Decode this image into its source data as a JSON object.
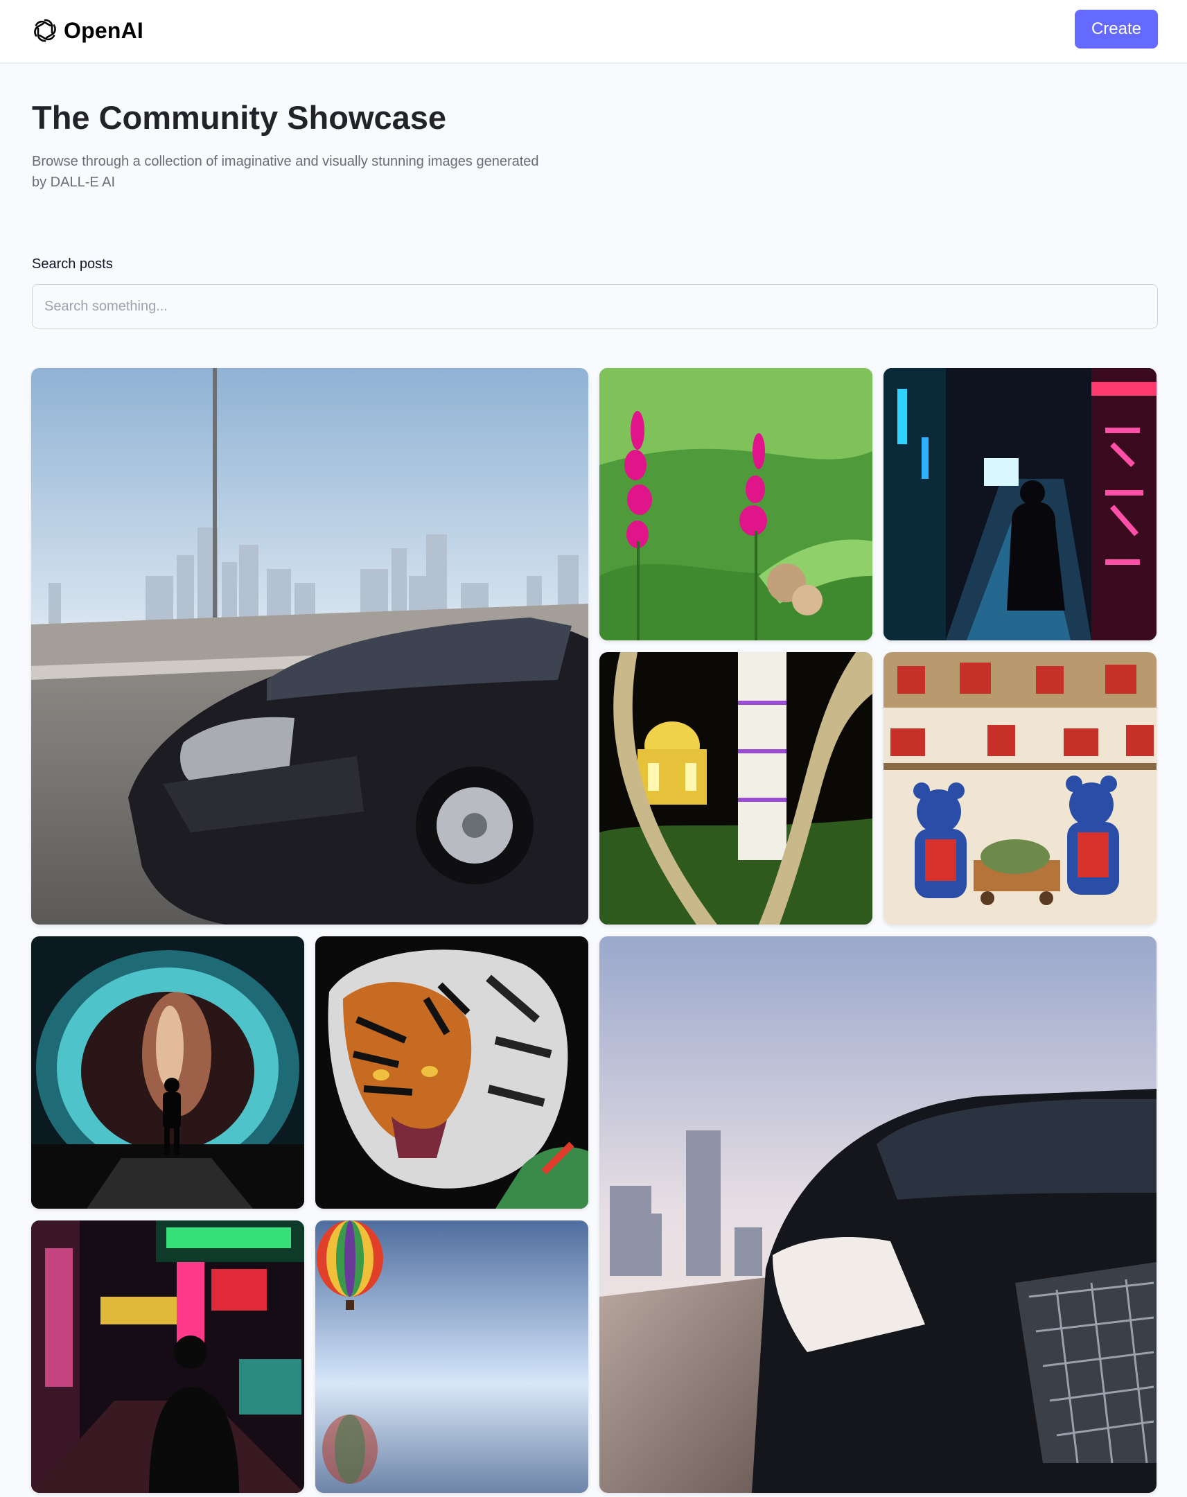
{
  "header": {
    "brand_name": "OpenAI",
    "create_label": "Create"
  },
  "hero": {
    "title": "The Community Showcase",
    "subtitle": "Browse through a collection of imaginative and visually stunning images generated by DALL-E AI"
  },
  "search": {
    "label": "Search posts",
    "placeholder": "Search something..."
  },
  "gallery": [
    {
      "name": "car-city-highway"
    },
    {
      "name": "pink-flowers"
    },
    {
      "name": "neon-alley"
    },
    {
      "name": "taj-mahal-night"
    },
    {
      "name": "teddy-bears-market"
    },
    {
      "name": "portal-galaxy"
    },
    {
      "name": "tiger-painting"
    },
    {
      "name": "car-closeup"
    },
    {
      "name": "neon-street"
    },
    {
      "name": "hot-air-balloon"
    }
  ],
  "colors": {
    "accent": "#6469ff",
    "background": "#f9fafe",
    "title": "#222328",
    "subtitle": "#666e75"
  }
}
